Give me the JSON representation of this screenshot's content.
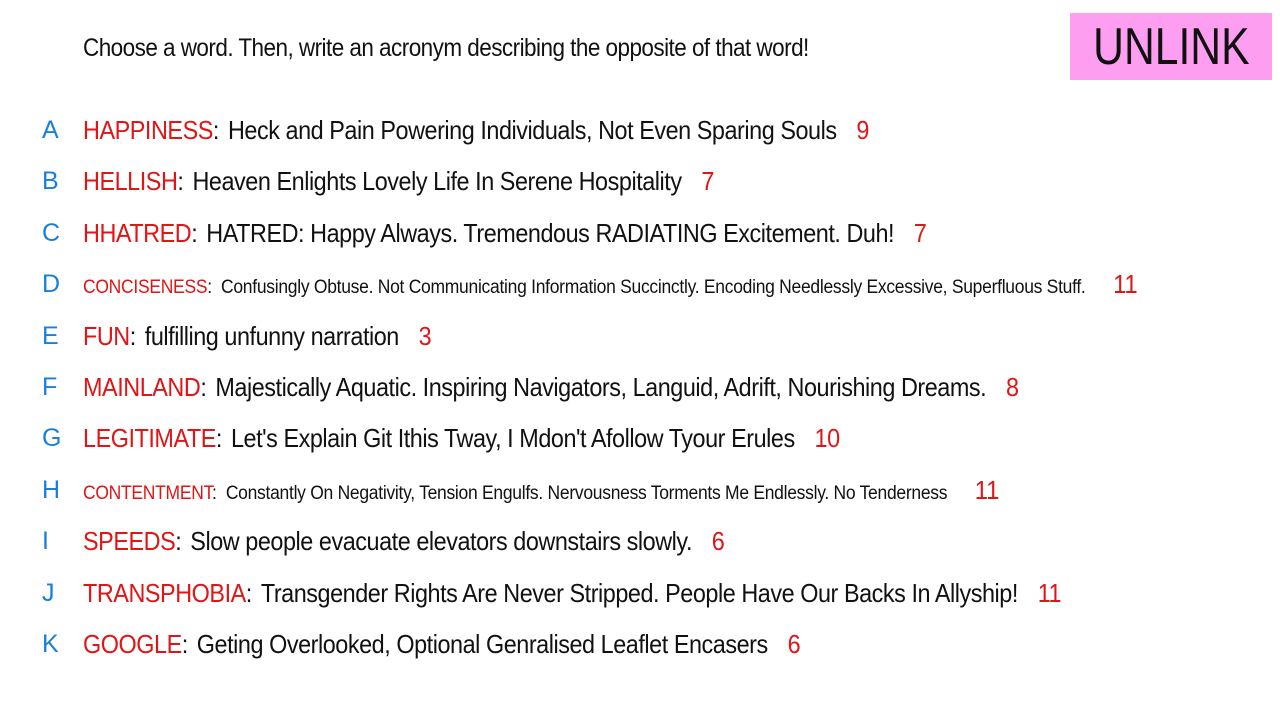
{
  "prompt": "Choose a word. Then, write an acronym describing the opposite of that word!",
  "brand": {
    "text": "UNLINK",
    "background": "#fe9ef0"
  },
  "colors": {
    "letter": "#1a7fd9",
    "word": "#e01515",
    "text": "#111111"
  },
  "entries": [
    {
      "letter": "A",
      "word": "HAPPINESS",
      "acronym": "Heck and Pain Powering Individuals, Not Even Sparing Souls",
      "count": "9"
    },
    {
      "letter": "B",
      "word": "HELLISH",
      "acronym": "Heaven Enlights Lovely Life In Serene Hospitality",
      "count": "7"
    },
    {
      "letter": "C",
      "word": "HHATRED",
      "acronym": "HATRED: Happy Always. Tremendous RADIATING Excitement. Duh!",
      "count": "7"
    },
    {
      "letter": "D",
      "word": "CONCISENESS",
      "acronym": "Confusingly Obtuse. Not Communicating Information Succinctly. Encoding Needlessly Excessive, Superfluous Stuff.",
      "count": "11"
    },
    {
      "letter": "E",
      "word": "FUN",
      "acronym": "fulfilling unfunny narration",
      "count": "3"
    },
    {
      "letter": "F",
      "word": "MAINLAND",
      "acronym": "Majestically Aquatic. Inspiring Navigators, Languid, Adrift, Nourishing Dreams.",
      "count": "8"
    },
    {
      "letter": "G",
      "word": "LEGITIMATE",
      "acronym": "Let's Explain Git Ithis Tway, I Mdon't Afollow Tyour Erules",
      "count": "10"
    },
    {
      "letter": "H",
      "word": "CONTENTMENT",
      "acronym": "Constantly On Negativity, Tension Engulfs. Nervousness Torments Me Endlessly. No Tenderness",
      "count": "11"
    },
    {
      "letter": "I",
      "word": "SPEEDS",
      "acronym": "Slow people evacuate elevators downstairs slowly.",
      "count": "6"
    },
    {
      "letter": "J",
      "word": "TRANSPHOBIA",
      "acronym": "Transgender Rights Are Never Stripped. People Have Our Backs In Allyship!",
      "count": "11"
    },
    {
      "letter": "K",
      "word": "GOOGLE",
      "acronym": "Geting Overlooked, Optional Genralised Leaflet Encasers",
      "count": "6"
    }
  ]
}
